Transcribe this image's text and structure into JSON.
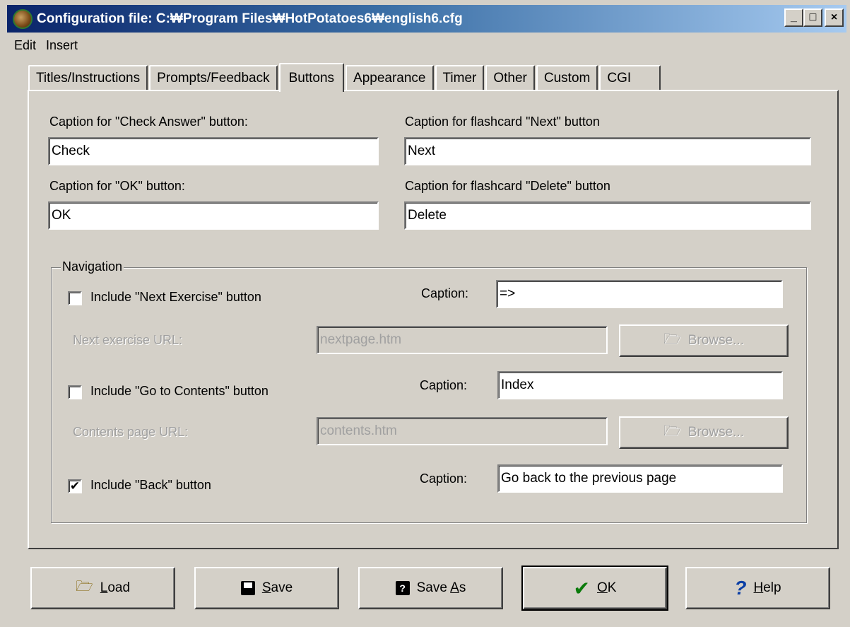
{
  "window": {
    "title": "Configuration file: C:₩Program Files₩HotPotatoes6₩english6.cfg"
  },
  "title_buttons": {
    "minimize": "_",
    "maximize": "□",
    "close": "×"
  },
  "menu": {
    "items": [
      "Edit",
      "Insert"
    ]
  },
  "tabs": [
    "Titles/Instructions",
    "Prompts/Feedback",
    "Buttons",
    "Appearance",
    "Timer",
    "Other",
    "Custom",
    "CGI"
  ],
  "active_tab": "Buttons",
  "captions": {
    "check_label": "Caption for \"Check Answer\" button:",
    "check_value": "Check",
    "next_label": "Caption for flashcard \"Next\" button",
    "next_value": "Next",
    "ok_label": "Caption for \"OK\" button:",
    "ok_value": "OK",
    "delete_label": "Caption for flashcard \"Delete\" button",
    "delete_value": "Delete"
  },
  "navigation": {
    "legend": "Navigation",
    "next_exercise": {
      "label": "Include \"Next Exercise\" button",
      "checked": false,
      "caption_label": "Caption:",
      "caption": "=>",
      "url_label": "Next exercise URL:",
      "url": "nextpage.htm",
      "browse": "Browse..."
    },
    "contents": {
      "label": "Include \"Go to Contents\" button",
      "checked": false,
      "caption_label": "Caption:",
      "caption": "Index",
      "url_label": "Contents page URL:",
      "url": "contents.htm",
      "browse": "Browse..."
    },
    "back": {
      "label": "Include \"Back\" button",
      "checked": true,
      "check_mark": "✔",
      "caption_label": "Caption:",
      "caption": "Go back to the previous page"
    }
  },
  "buttons": {
    "load": {
      "label": "Load",
      "underline": "L",
      "rest": "oad",
      "icon": "open-folder-icon"
    },
    "save": {
      "label": "Save",
      "underline": "S",
      "rest": "ave",
      "icon": "floppy-disk-icon"
    },
    "save_as": {
      "label": "Save As",
      "pre": "Save ",
      "underline": "A",
      "rest": "s",
      "icon": "save-as-icon"
    },
    "ok": {
      "label": "OK",
      "underline": "O",
      "rest": "K",
      "icon": "check-mark-icon"
    },
    "help": {
      "label": "Help",
      "underline": "H",
      "rest": "elp",
      "icon": "question-mark-icon"
    }
  }
}
